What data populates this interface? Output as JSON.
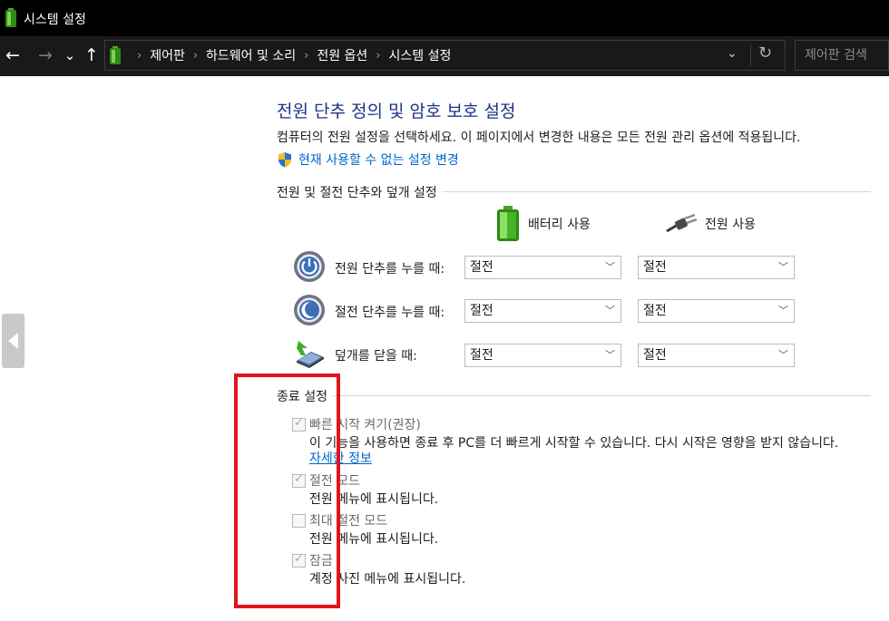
{
  "window": {
    "title": "시스템 설정"
  },
  "nav": {
    "back": "←",
    "forward": "→",
    "recent": "⌄",
    "up": "↑",
    "breadcrumbs": [
      "제어판",
      "하드웨어 및 소리",
      "전원 옵션",
      "시스템 설정"
    ],
    "breadcrumb_sep": "›",
    "dropdown": "⌄",
    "refresh": "↻",
    "search_placeholder": "제어판 검색"
  },
  "main": {
    "title": "전원 단추 정의 및 암호 보호 설정",
    "description": "컴퓨터의 전원 설정을 선택하세요. 이 페이지에서 변경한 내용은 모든 전원 관리 옵션에 적용됩니다.",
    "admin_link": "현재 사용할 수 없는 설정 변경"
  },
  "power_section": {
    "title": "전원 및 절전 단추와 덮개 설정",
    "col_battery": "배터리 사용",
    "col_plugged": "전원 사용",
    "rows": [
      {
        "label": "전원 단추를 누를 때:",
        "battery": "절전",
        "plugged": "절전",
        "icon": "power-button-icon"
      },
      {
        "label": "절전 단추를 누를 때:",
        "battery": "절전",
        "plugged": "절전",
        "icon": "sleep-button-icon"
      },
      {
        "label": "덮개를 닫을 때:",
        "battery": "절전",
        "plugged": "절전",
        "icon": "laptop-lid-icon"
      }
    ]
  },
  "shutdown_section": {
    "title": "종료 설정",
    "options": [
      {
        "label": "빠른 시작 켜기(권장)",
        "checked": true,
        "description": "이 기능을 사용하면 종료 후 PC를 더 빠르게 시작할 수 있습니다. 다시 시작은 영향을 받지 않습니다.",
        "link": "자세한 정보"
      },
      {
        "label": "절전 모드",
        "checked": true,
        "description": "전원 메뉴에 표시됩니다."
      },
      {
        "label": "최대 절전 모드",
        "checked": false,
        "description": "전원 메뉴에 표시됩니다."
      },
      {
        "label": "잠금",
        "checked": true,
        "description": "계정 사진 메뉴에 표시됩니다."
      }
    ]
  },
  "colors": {
    "title_blue": "#1e3287",
    "link_blue": "#0066cc",
    "highlight_red": "#e0141e"
  }
}
